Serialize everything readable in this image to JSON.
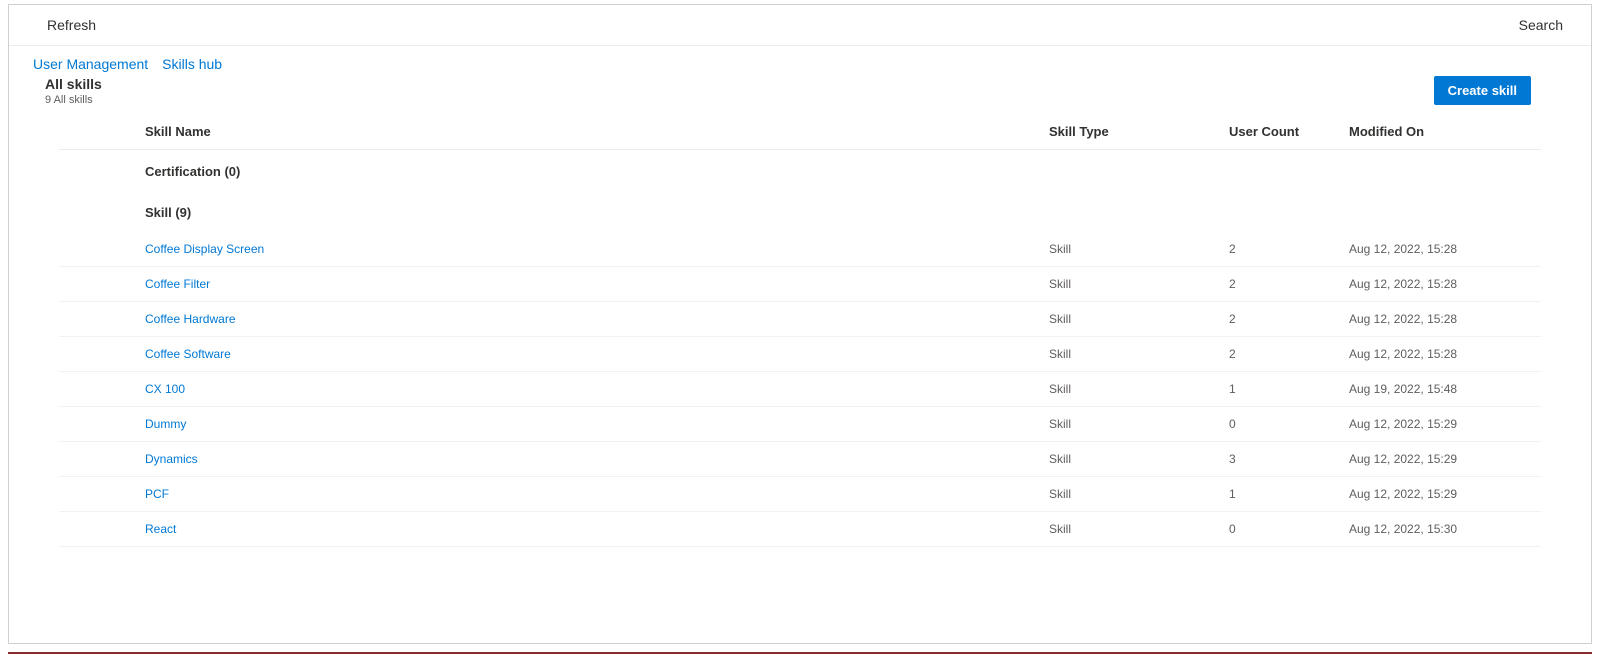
{
  "commandBar": {
    "refresh": "Refresh",
    "search": "Search"
  },
  "breadcrumb": {
    "items": [
      {
        "label": "User Management"
      },
      {
        "label": "Skills hub"
      }
    ]
  },
  "header": {
    "title": "All skills",
    "subtitle": "9 All skills",
    "createButton": "Create skill"
  },
  "columns": {
    "name": "Skill Name",
    "type": "Skill Type",
    "userCount": "User Count",
    "modified": "Modified On"
  },
  "groups": [
    {
      "label": "Certification (0)",
      "rows": []
    },
    {
      "label": "Skill (9)",
      "rows": [
        {
          "name": "Coffee Display Screen",
          "type": "Skill",
          "userCount": "2",
          "modified": "Aug 12, 2022, 15:28"
        },
        {
          "name": "Coffee Filter",
          "type": "Skill",
          "userCount": "2",
          "modified": "Aug 12, 2022, 15:28"
        },
        {
          "name": "Coffee Hardware",
          "type": "Skill",
          "userCount": "2",
          "modified": "Aug 12, 2022, 15:28"
        },
        {
          "name": "Coffee Software",
          "type": "Skill",
          "userCount": "2",
          "modified": "Aug 12, 2022, 15:28"
        },
        {
          "name": "CX 100",
          "type": "Skill",
          "userCount": "1",
          "modified": "Aug 19, 2022, 15:48"
        },
        {
          "name": "Dummy",
          "type": "Skill",
          "userCount": "0",
          "modified": "Aug 12, 2022, 15:29"
        },
        {
          "name": "Dynamics",
          "type": "Skill",
          "userCount": "3",
          "modified": "Aug 12, 2022, 15:29"
        },
        {
          "name": "PCF",
          "type": "Skill",
          "userCount": "1",
          "modified": "Aug 12, 2022, 15:29"
        },
        {
          "name": "React",
          "type": "Skill",
          "userCount": "0",
          "modified": "Aug 12, 2022, 15:30"
        }
      ]
    }
  ]
}
